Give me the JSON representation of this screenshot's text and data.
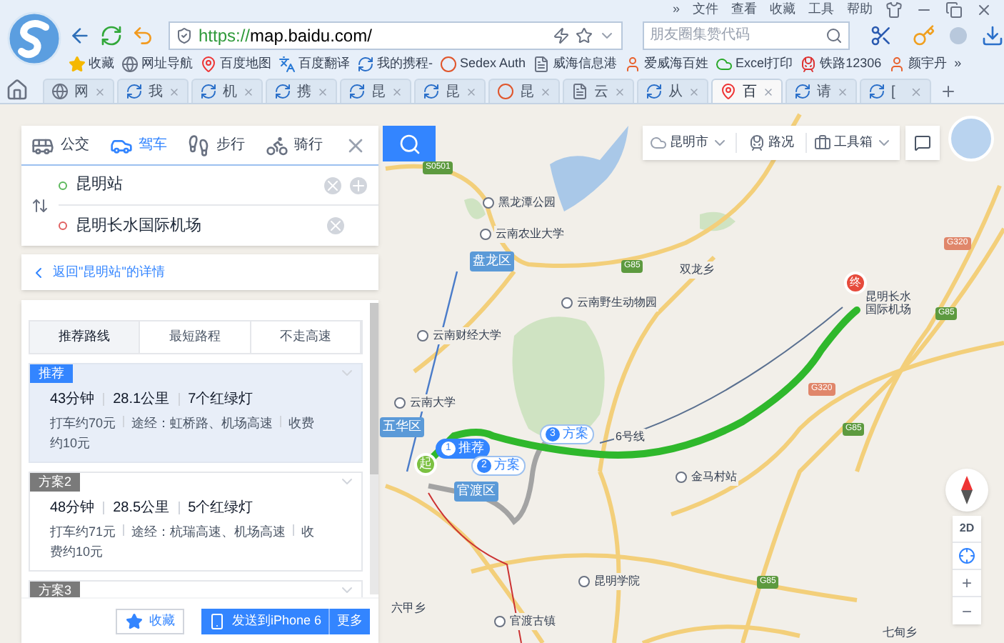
{
  "browser": {
    "menu": [
      "»",
      "文件",
      "查看",
      "收藏",
      "工具",
      "帮助"
    ],
    "url": {
      "scheme": "https://",
      "host": "map.baidu.com/"
    },
    "search_placeholder": "朋友圈集赞代码",
    "bookmarks": [
      {
        "label": "收藏",
        "kind": "star"
      },
      {
        "label": "网址导航",
        "kind": "globe"
      },
      {
        "label": "百度地图",
        "kind": "pin"
      },
      {
        "label": "百度翻译",
        "kind": "translate"
      },
      {
        "label": "我的携程-",
        "kind": "swirl"
      },
      {
        "label": "Sedex Auth",
        "kind": "s"
      },
      {
        "label": "威海信息港",
        "kind": "page"
      },
      {
        "label": "爱威海百姓",
        "kind": "person"
      },
      {
        "label": "Excel打印",
        "kind": "cloud"
      },
      {
        "label": "铁路12306",
        "kind": "rail"
      },
      {
        "label": "颜宇丹",
        "kind": "person"
      },
      {
        "label": "»",
        "kind": "more"
      }
    ],
    "tabs": [
      {
        "label": "网",
        "kind": "globe",
        "selected": false
      },
      {
        "label": "我",
        "kind": "swirl",
        "selected": false
      },
      {
        "label": "机",
        "kind": "swirl",
        "selected": false
      },
      {
        "label": "携",
        "kind": "swirl",
        "selected": false
      },
      {
        "label": "昆",
        "kind": "swirl",
        "selected": false
      },
      {
        "label": "昆",
        "kind": "swirl",
        "selected": false
      },
      {
        "label": "昆",
        "kind": "s",
        "selected": false
      },
      {
        "label": "云",
        "kind": "page",
        "selected": false
      },
      {
        "label": "从",
        "kind": "swirl",
        "selected": false
      },
      {
        "label": "百",
        "kind": "pin",
        "selected": true
      },
      {
        "label": "请",
        "kind": "swirl",
        "selected": false
      },
      {
        "label": "[",
        "kind": "swirl",
        "selected": false
      }
    ]
  },
  "route_panel": {
    "modes": [
      {
        "label": "公交",
        "kind": "bus",
        "selected": false
      },
      {
        "label": "驾车",
        "kind": "car",
        "selected": true
      },
      {
        "label": "步行",
        "kind": "walk",
        "selected": false
      },
      {
        "label": "骑行",
        "kind": "bike",
        "selected": false
      }
    ],
    "start": "昆明站",
    "end": "昆明长水国际机场",
    "back_link": "返回\"昆明站\"的详情",
    "strategy_tabs": [
      {
        "label": "推荐路线",
        "selected": true
      },
      {
        "label": "最短路程",
        "selected": false
      },
      {
        "label": "不走高速",
        "selected": false
      }
    ],
    "routes": [
      {
        "badge": "推荐",
        "selected": true,
        "time": "43分钟",
        "distance": "28.1公里",
        "lights": "7个红绿灯",
        "taxi": "打车约70元",
        "via": "途经：虹桥路、机场高速",
        "toll": "收费约10元"
      },
      {
        "badge": "方案2",
        "selected": false,
        "time": "48分钟",
        "distance": "28.5公里",
        "lights": "5个红绿灯",
        "taxi": "打车约71元",
        "via": "途经：杭瑞高速、机场高速",
        "toll": "收费约10元"
      },
      {
        "badge": "方案3",
        "selected": false
      }
    ],
    "footer": {
      "save": "收藏",
      "send": "发送到iPhone 6",
      "more": "更多"
    }
  },
  "map": {
    "toolbar": {
      "city": "昆明市",
      "traffic": "路况",
      "toolbox": "工具箱"
    },
    "places": [
      "黑龙潭公园",
      "云南农业大学",
      "云南野生动物园",
      "云南财经大学",
      "云南大学",
      "金马村站",
      "昆明学院",
      "官渡古镇"
    ],
    "plain_labels": [
      "双龙乡",
      "六甲乡",
      "七甸乡",
      "6号线"
    ],
    "districts": [
      "盘龙区",
      "五华区",
      "官渡区"
    ],
    "airport": [
      "昆明长水",
      "国际机场"
    ],
    "road_shields": [
      {
        "label": "S0501",
        "color": "#5d9a3f"
      },
      {
        "label": "G85",
        "color": "#5d9a3f"
      },
      {
        "label": "G320",
        "color": "#e0866a"
      },
      {
        "label": "G85",
        "color": "#5d9a3f"
      },
      {
        "label": "G320",
        "color": "#e0866a"
      },
      {
        "label": "G85",
        "color": "#5d9a3f"
      },
      {
        "label": "G85",
        "color": "#5d9a3f"
      }
    ],
    "start_marker": "起",
    "end_marker": "终",
    "route_labels": [
      {
        "number": "1",
        "label": "推荐",
        "selected": true
      },
      {
        "number": "2",
        "label": "方案",
        "selected": false
      },
      {
        "number": "3",
        "label": "方案",
        "selected": false
      }
    ],
    "controls": {
      "view": "2D",
      "zoom_in": "+",
      "zoom_out": "−"
    }
  }
}
